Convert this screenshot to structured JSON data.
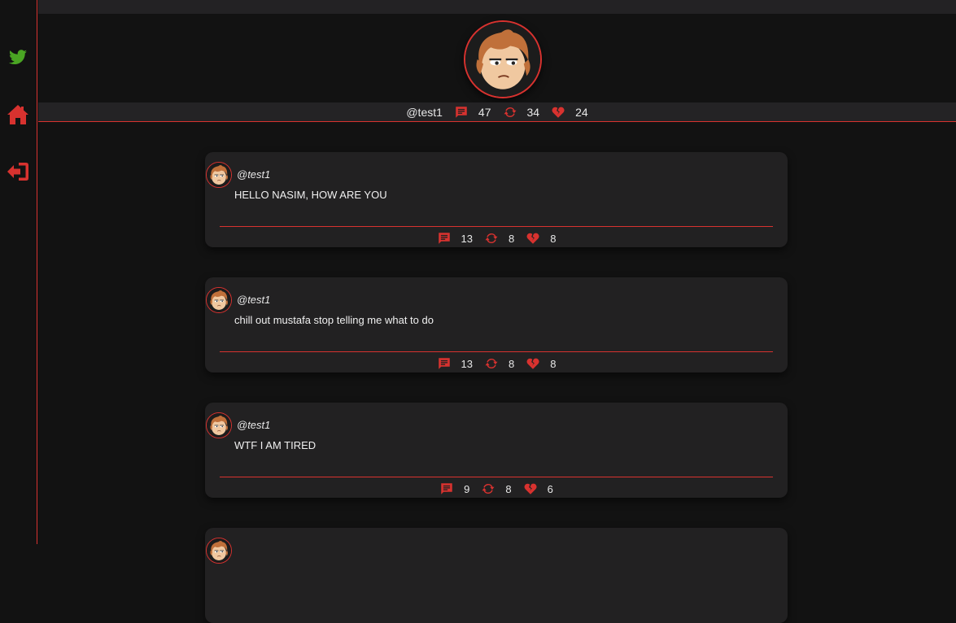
{
  "brand": {
    "accent": "#d8322f",
    "logo_color": "#4aa523"
  },
  "sidebar": {
    "items": [
      {
        "icon": "bird-logo-icon"
      },
      {
        "icon": "home-icon"
      },
      {
        "icon": "logout-icon"
      }
    ]
  },
  "profile": {
    "handle": "@test1",
    "comments": "47",
    "retweets": "34",
    "likes": "24"
  },
  "posts": [
    {
      "handle": "@test1",
      "text": "HELLO NASIM, HOW ARE YOU",
      "comments": "13",
      "retweets": "8",
      "likes": "8"
    },
    {
      "handle": "@test1",
      "text": "chill out mustafa stop telling me what to do",
      "comments": "13",
      "retweets": "8",
      "likes": "8"
    },
    {
      "handle": "@test1",
      "text": "WTF I AM TIRED",
      "comments": "9",
      "retweets": "8",
      "likes": "6"
    },
    {
      "handle": "",
      "text": "",
      "comments": "",
      "retweets": "",
      "likes": ""
    }
  ]
}
